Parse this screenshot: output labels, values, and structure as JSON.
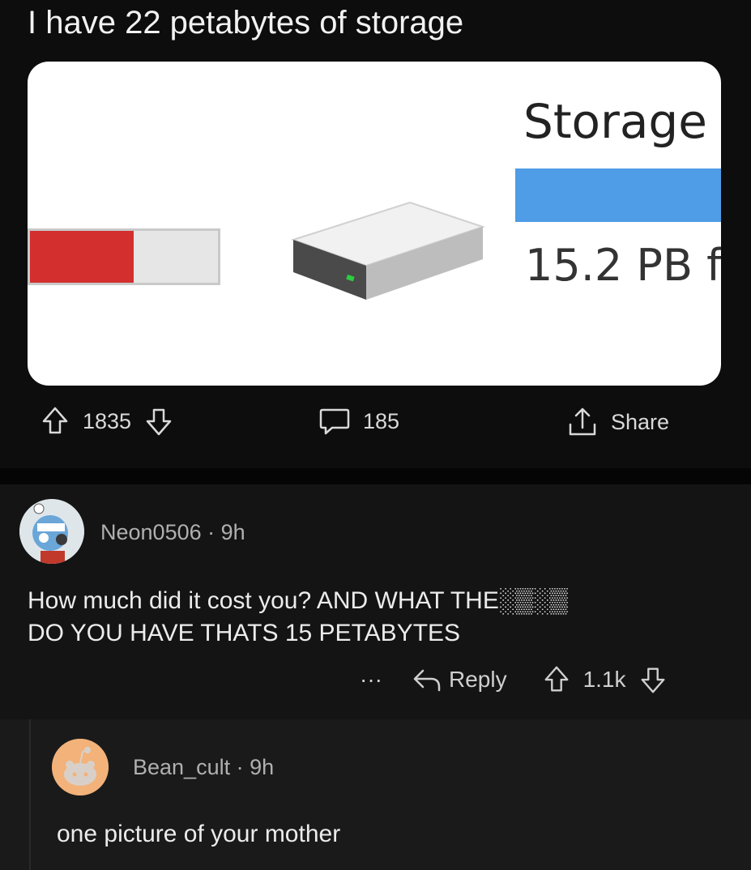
{
  "post": {
    "title": "I have 22 petabytes of storage",
    "image": {
      "storage_label": "Storage",
      "free_label": "15.2 PB f",
      "left_bar_fill": 0.55,
      "right_bar_fill": 1.0,
      "colors": {
        "red": "#d32f2f",
        "blue": "#4f9de6"
      }
    },
    "votes": "1835",
    "comments": "185",
    "share_label": "Share"
  },
  "comments": [
    {
      "author": "Neon0506",
      "separator": "·",
      "age": "9h",
      "text_line1": "How much did it cost you? AND WHAT THE░▒░▒",
      "text_line2": "DO YOU HAVE THATS 15 PETABYTES",
      "more": "···",
      "reply_label": "Reply",
      "votes": "1.1k"
    },
    {
      "author": "Bean_cult",
      "separator": "·",
      "age": "9h",
      "text": "one picture of your mother"
    }
  ]
}
